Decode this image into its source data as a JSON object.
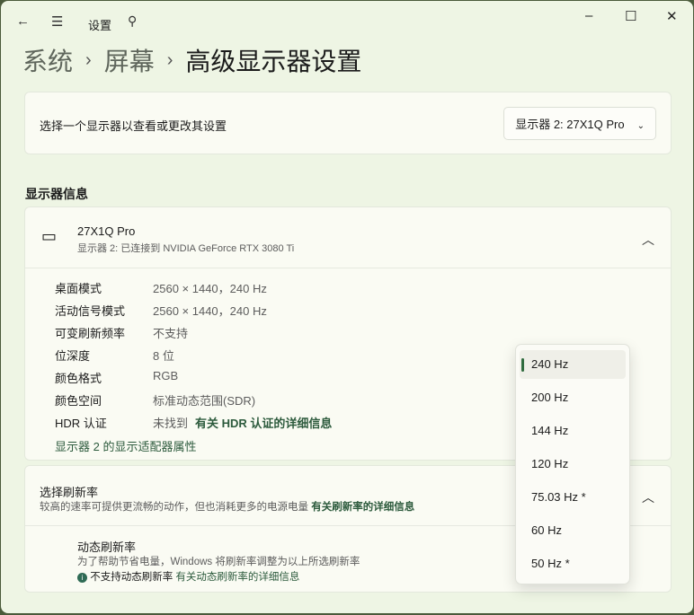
{
  "window": {
    "title": "设置"
  },
  "breadcrumb": [
    "系统",
    "屏幕",
    "高级显示器设置"
  ],
  "selector": {
    "label": "选择一个显示器以查看或更改其设置",
    "value": "显示器 2: 27X1Q Pro"
  },
  "section_title": "显示器信息",
  "monitor": {
    "name": "27X1Q Pro",
    "subtitle": "显示器 2: 已连接到 NVIDIA GeForce RTX 3080 Ti",
    "info": [
      {
        "k": "桌面模式",
        "v": "2560 × 1440，240 Hz"
      },
      {
        "k": "活动信号模式",
        "v": "2560 × 1440，240 Hz"
      },
      {
        "k": "可变刷新频率",
        "v": "不支持"
      },
      {
        "k": "位深度",
        "v": "8 位"
      },
      {
        "k": "颜色格式",
        "v": "RGB"
      },
      {
        "k": "颜色空间",
        "v": "标准动态范围(SDR)"
      },
      {
        "k": "HDR 认证",
        "v": "未找到"
      }
    ],
    "hdr_link": "有关 HDR 认证的详细信息",
    "adapter_link": "显示器 2 的显示适配器属性"
  },
  "refresh": {
    "title": "选择刷新率",
    "desc": "较高的速率可提供更流畅的动作，但也消耗更多的电源电量",
    "link": "有关刷新率的详细信息",
    "dynamic_title": "动态刷新率",
    "dynamic_desc": "为了帮助节省电量，Windows 将刷新率调整为以上所选刷新率",
    "unsupported": "不支持动态刷新率",
    "dynamic_link": "有关动态刷新率的详细信息"
  },
  "dropdown": {
    "options": [
      "240 Hz",
      "200 Hz",
      "144 Hz",
      "120 Hz",
      "75.03 Hz *",
      "60 Hz",
      "50 Hz *"
    ],
    "selected": "240 Hz"
  }
}
